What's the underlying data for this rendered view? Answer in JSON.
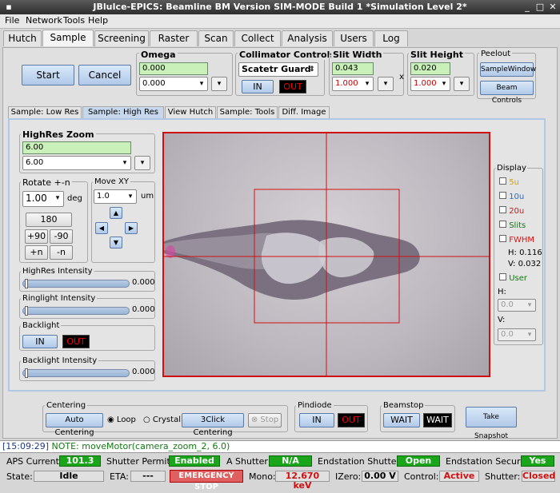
{
  "window": {
    "title": "JBluIce-EPICS: Beamline BM Version SIM-MODE Build 1 *Simulation Level 2*"
  },
  "menu": [
    "File",
    "Network",
    "Tools",
    "Help"
  ],
  "tabs": [
    "Hutch",
    "Sample",
    "Screening",
    "Raster",
    "Scan",
    "Collect",
    "Analysis",
    "Users",
    "Log"
  ],
  "controls": {
    "start": "Start",
    "cancel": "Cancel"
  },
  "omega": {
    "label": "Omega",
    "value": "0.000",
    "combo": "0.000"
  },
  "collimator": {
    "label": "Collimator Controls",
    "selected": "Scatetr Guard",
    "in": "IN",
    "out": "OUT"
  },
  "slit_width": {
    "label": "Slit Width",
    "value": "0.043",
    "combo": "1.000"
  },
  "slit_height": {
    "label": "Slit Height",
    "value": "0.020",
    "combo": "1.000",
    "x": "x"
  },
  "peelout": {
    "label": "Peelout",
    "sample_window": "SampleWindow",
    "beam_controls": "Beam Controls"
  },
  "subtabs": [
    "Sample: Low Res",
    "Sample: High Res",
    "View Hutch",
    "Sample: Tools",
    "Diff. Image"
  ],
  "zoom": {
    "label": "HighRes Zoom",
    "value": "6.00",
    "combo": "6.00"
  },
  "rotate": {
    "label": "Rotate +-n",
    "value": "1.00",
    "unit": "deg",
    "b180": "180",
    "p90": "+90",
    "m90": "-90",
    "pn": "+n",
    "mn": "-n"
  },
  "movexy": {
    "label": "Move XY",
    "value": "1.0",
    "unit": "um"
  },
  "highres_intensity": {
    "label": "HighRes Intensity",
    "value": "0.000"
  },
  "ringlight_intensity": {
    "label": "Ringlight Intensity",
    "value": "0.000"
  },
  "backlight": {
    "label": "Backlight",
    "in": "IN",
    "out": "OUT"
  },
  "backlight_intensity": {
    "label": "Backlight Intensity",
    "value": "0.000"
  },
  "display": {
    "label": "Display",
    "items": [
      {
        "label": "5u",
        "color": "#d4a000"
      },
      {
        "label": "10u",
        "color": "#2a6ad0"
      },
      {
        "label": "20u",
        "color": "#c02020"
      },
      {
        "label": "Slits",
        "color": "#107a10"
      },
      {
        "label": "FWHM",
        "color": "#e01010"
      }
    ],
    "h_value": "H: 0.116",
    "v_value": "V: 0.032",
    "user": {
      "label": "User",
      "color": "#107a10"
    },
    "h_label": "H:",
    "v_label": "V:",
    "combo_value": "0.0"
  },
  "centering": {
    "label": "Centering",
    "auto": "Auto Centering",
    "loop": "Loop",
    "crystal": "Crystal",
    "threeclick": "3Click Centering",
    "stop": "Stop"
  },
  "pindiode": {
    "label": "Pindiode",
    "in": "IN",
    "out": "OUT"
  },
  "beamstop": {
    "label": "Beamstop",
    "wait1": "WAIT",
    "wait2": "WAIT"
  },
  "snapshot": "Take Snapshot",
  "log": {
    "time": "[15:09:29]",
    "message": " NOTE: moveMotor(camera_zoom_2, 6.0)"
  },
  "status": {
    "aps_current_label": "APS Current",
    "aps_current": "101.3",
    "shutter_permit_label": "Shutter Permit",
    "shutter_permit": "Enabled",
    "a_shutter_label": "A Shutter",
    "a_shutter": "N/A",
    "endstation_shutter_label": "Endstation Shutter",
    "endstation_shutter": "Open",
    "endstation_secure_label": "Endstation Secure",
    "endstation_secure": "Yes",
    "state_label": "State:",
    "state": "Idle",
    "eta_label": "ETA:",
    "eta": "---",
    "emergency": "EMERGENCY STOP",
    "mono_label": "Mono:",
    "mono": "12.670 keV",
    "izero_label": "IZero:",
    "izero": "0.00 V",
    "control_label": "Control:",
    "control": "Active",
    "shutter_label": "Shutter:",
    "shutter": "Closed"
  }
}
